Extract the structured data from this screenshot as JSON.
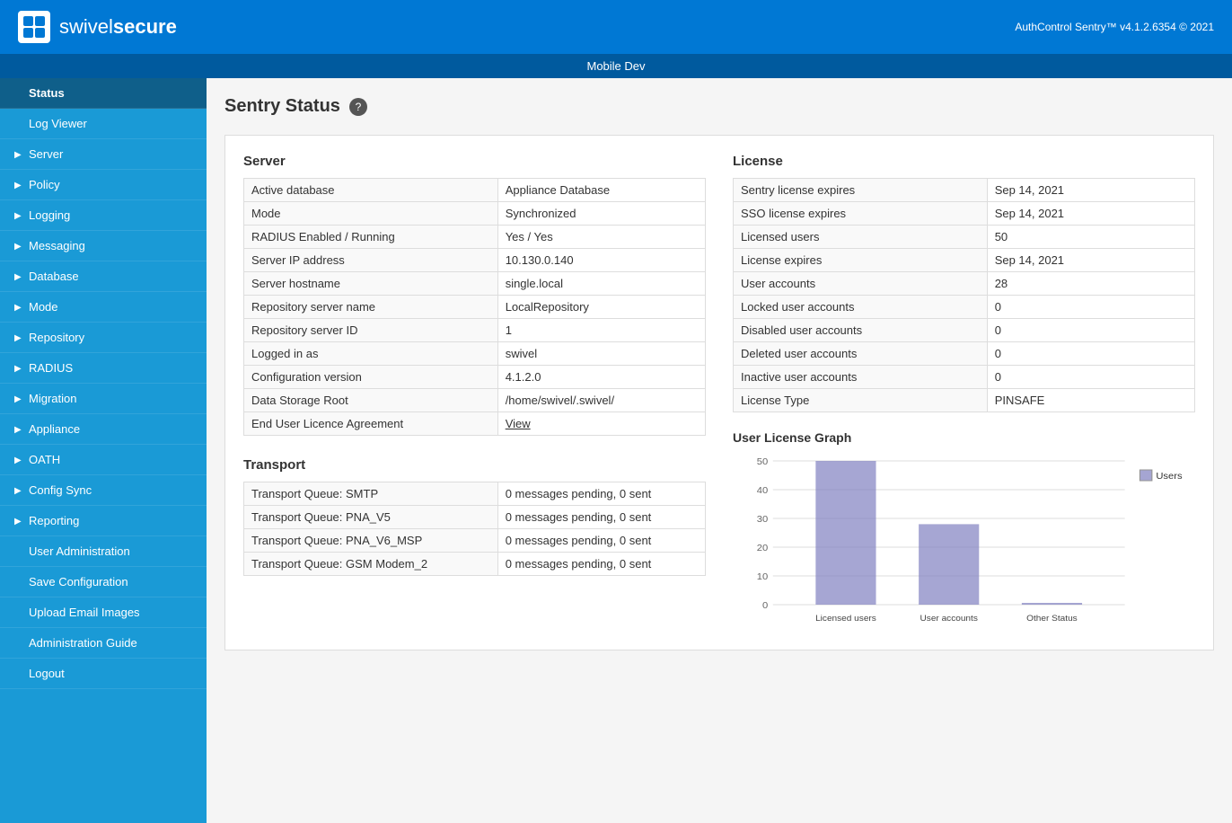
{
  "header": {
    "app_name": "swivel",
    "app_name_bold": "secure",
    "version": "AuthControl Sentry™ v4.1.2.6354 © 2021",
    "instance": "Mobile Dev"
  },
  "sidebar": {
    "items": [
      {
        "label": "Status",
        "active": true,
        "arrow": false,
        "indent": false
      },
      {
        "label": "Log Viewer",
        "active": false,
        "arrow": false,
        "indent": false
      },
      {
        "label": "Server",
        "active": false,
        "arrow": true,
        "indent": false
      },
      {
        "label": "Policy",
        "active": false,
        "arrow": true,
        "indent": false
      },
      {
        "label": "Logging",
        "active": false,
        "arrow": true,
        "indent": false
      },
      {
        "label": "Messaging",
        "active": false,
        "arrow": true,
        "indent": false
      },
      {
        "label": "Database",
        "active": false,
        "arrow": true,
        "indent": false
      },
      {
        "label": "Mode",
        "active": false,
        "arrow": true,
        "indent": false
      },
      {
        "label": "Repository",
        "active": false,
        "arrow": true,
        "indent": false
      },
      {
        "label": "RADIUS",
        "active": false,
        "arrow": true,
        "indent": false
      },
      {
        "label": "Migration",
        "active": false,
        "arrow": true,
        "indent": false
      },
      {
        "label": "Appliance",
        "active": false,
        "arrow": true,
        "indent": false
      },
      {
        "label": "OATH",
        "active": false,
        "arrow": true,
        "indent": false
      },
      {
        "label": "Config Sync",
        "active": false,
        "arrow": true,
        "indent": false
      },
      {
        "label": "Reporting",
        "active": false,
        "arrow": true,
        "indent": false
      },
      {
        "label": "User Administration",
        "active": false,
        "arrow": false,
        "indent": false
      },
      {
        "label": "Save Configuration",
        "active": false,
        "arrow": false,
        "indent": false
      },
      {
        "label": "Upload Email Images",
        "active": false,
        "arrow": false,
        "indent": false
      },
      {
        "label": "Administration Guide",
        "active": false,
        "arrow": false,
        "indent": false
      },
      {
        "label": "Logout",
        "active": false,
        "arrow": false,
        "indent": false
      }
    ]
  },
  "page": {
    "title": "Sentry Status",
    "help_char": "?"
  },
  "server_section": {
    "title": "Server",
    "rows": [
      {
        "label": "Active database",
        "value": "Appliance Database",
        "style": "green"
      },
      {
        "label": "Mode",
        "value": "Synchronized",
        "style": "green"
      },
      {
        "label": "RADIUS Enabled / Running",
        "value": "Yes / Yes",
        "style": "green"
      },
      {
        "label": "Server IP address",
        "value": "10.130.0.140",
        "style": "green"
      },
      {
        "label": "Server hostname",
        "value": "single.local",
        "style": "green"
      },
      {
        "label": "Repository server name",
        "value": "LocalRepository",
        "style": "green"
      },
      {
        "label": "Repository server ID",
        "value": "1",
        "style": "green"
      },
      {
        "label": "Logged in as",
        "value": "swivel",
        "style": "green"
      },
      {
        "label": "Configuration version",
        "value": "4.1.2.0",
        "style": "plain"
      },
      {
        "label": "Data Storage Root",
        "value": "/home/swivel/.swivel/",
        "style": "green"
      },
      {
        "label": "End User Licence Agreement",
        "value": "View",
        "style": "link"
      }
    ]
  },
  "transport_section": {
    "title": "Transport",
    "rows": [
      {
        "label": "Transport Queue: SMTP",
        "value": "0 messages pending, 0 sent",
        "style": "green"
      },
      {
        "label": "Transport Queue: PNA_V5",
        "value": "0 messages pending, 0 sent",
        "style": "green"
      },
      {
        "label": "Transport Queue: PNA_V6_MSP",
        "value": "0 messages pending, 0 sent",
        "style": "green"
      },
      {
        "label": "Transport Queue: GSM Modem_2",
        "value": "0 messages pending, 0 sent",
        "style": "green"
      }
    ]
  },
  "license_section": {
    "title": "License",
    "rows": [
      {
        "label": "Sentry license expires",
        "value": "Sep 14, 2021",
        "style": "orange"
      },
      {
        "label": "SSO license expires",
        "value": "Sep 14, 2021",
        "style": "orange"
      },
      {
        "label": "Licensed users",
        "value": "50",
        "style": "plain"
      },
      {
        "label": "License expires",
        "value": "Sep 14, 2021",
        "style": "orange"
      },
      {
        "label": "User accounts",
        "value": "28",
        "style": "plain"
      },
      {
        "label": "Locked user accounts",
        "value": "0",
        "style": "plain",
        "label_style": "link"
      },
      {
        "label": "Disabled user accounts",
        "value": "0",
        "style": "plain",
        "label_style": "link"
      },
      {
        "label": "Deleted user accounts",
        "value": "0",
        "style": "plain",
        "label_style": "link"
      },
      {
        "label": "Inactive user accounts",
        "value": "0",
        "style": "plain",
        "label_style": "link"
      },
      {
        "label": "License Type",
        "value": "PINSAFE",
        "style": "plain"
      }
    ]
  },
  "chart": {
    "title": "User License Graph",
    "legend": "Users",
    "bars": [
      {
        "label": "Licensed users",
        "value": 50,
        "height_pct": 100
      },
      {
        "label": "User accounts",
        "value": 28,
        "height_pct": 56
      },
      {
        "label": "Other Status",
        "value": 0,
        "height_pct": 2
      }
    ],
    "y_labels": [
      "50",
      "40",
      "30",
      "20",
      "10",
      "0"
    ],
    "max": 50
  }
}
